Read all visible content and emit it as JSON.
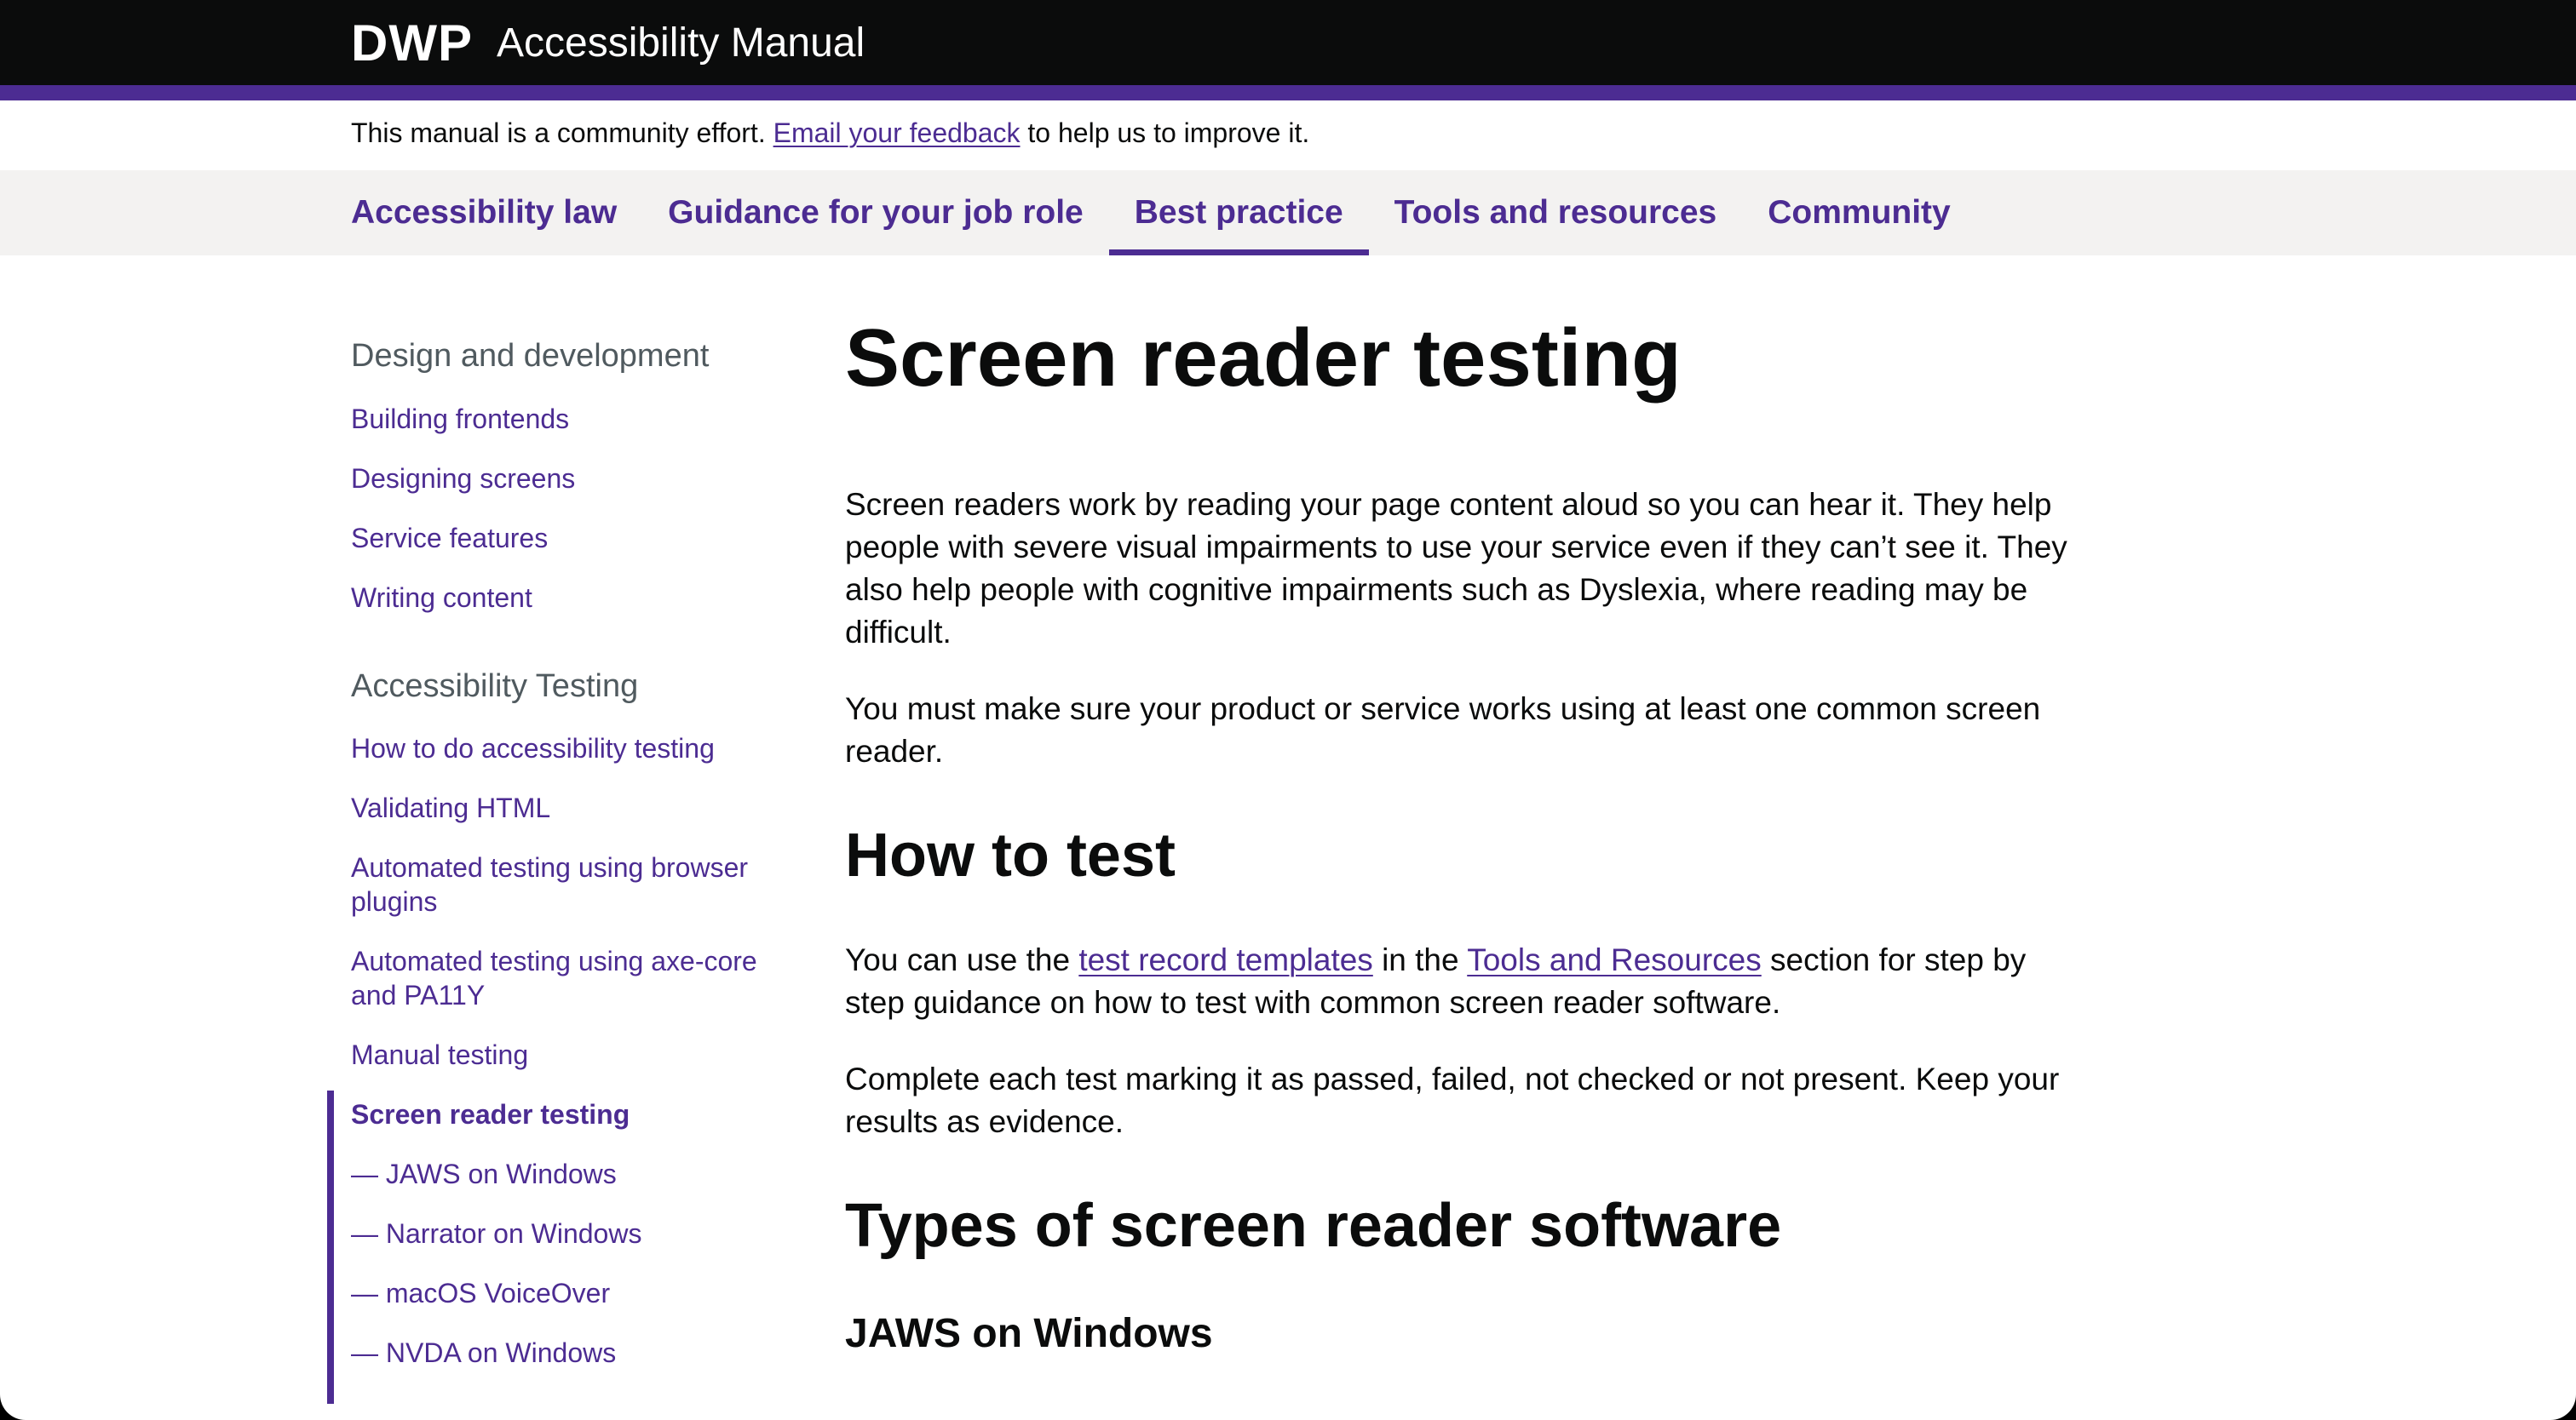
{
  "header": {
    "logo": "DWP",
    "title": "Accessibility Manual",
    "colors": {
      "background": "#0b0c0c",
      "accent": "#4c2c92"
    }
  },
  "feedback": {
    "before": "This manual is a community effort.",
    "link": "Email your feedback",
    "after": "to help us to improve it."
  },
  "nav": {
    "items": [
      {
        "label": "Accessibility law"
      },
      {
        "label": "Guidance for your job role"
      },
      {
        "label": "Best practice",
        "active": true
      },
      {
        "label": "Tools and resources"
      },
      {
        "label": "Community"
      }
    ]
  },
  "sidebar": {
    "sections": [
      {
        "heading": "Design and development",
        "links": [
          "Building frontends",
          "Designing screens",
          "Service features",
          "Writing content"
        ]
      },
      {
        "heading": "Accessibility Testing",
        "links": [
          "How to do accessibility testing",
          "Validating HTML",
          "Automated testing using browser plugins",
          "Automated testing using axe-core and PA11Y",
          "Manual testing"
        ],
        "current": {
          "label": "Screen reader testing",
          "children": [
            "— JAWS on Windows",
            "— Narrator on Windows",
            "— macOS VoiceOver",
            "— NVDA on Windows"
          ]
        }
      }
    ]
  },
  "main": {
    "title": "Screen reader testing",
    "intro_p1": "Screen readers work by reading your page content aloud so you can hear it. They help people with severe visual impairments to use your service even if they can’t see it. They also help people with cognitive impairments such as Dyslexia, where reading may be difficult.",
    "intro_p2": "You must make sure your product or service works using at least one common screen reader.",
    "how_heading": "How to test",
    "how_p1": {
      "t1": "You can use the",
      "link1": "test record templates",
      "t2": "in the",
      "link2": "Tools and Resources",
      "t3": "section for step by step guidance on how to test with common screen reader software."
    },
    "how_p2": "Complete each test marking it as passed, failed, not checked or not present. Keep your results as evidence.",
    "types_heading": "Types of screen reader software",
    "jaws_heading": "JAWS on Windows"
  }
}
